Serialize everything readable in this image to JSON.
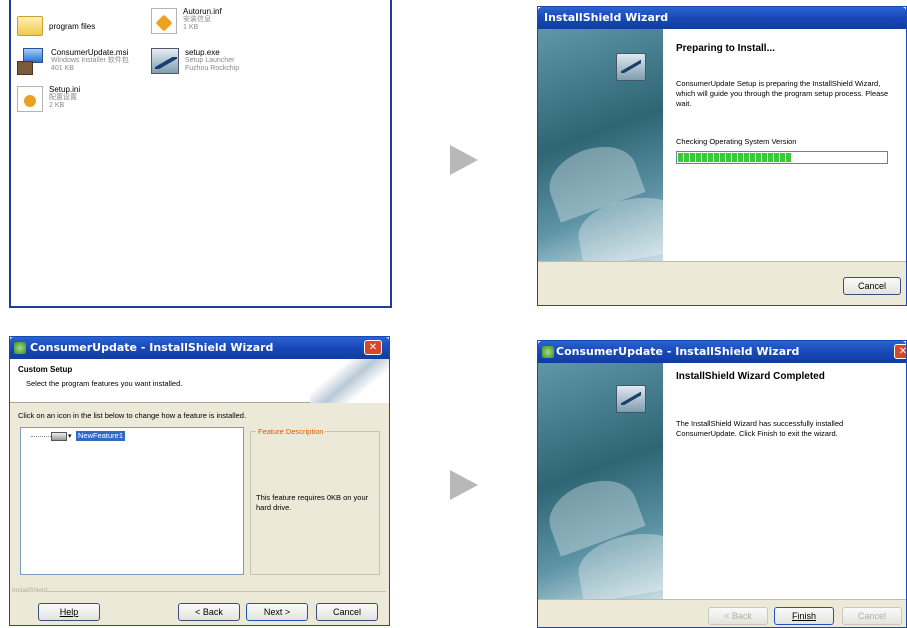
{
  "explorer": {
    "files": [
      {
        "name": "program files",
        "type": "",
        "size": "",
        "icon": "folder-icon"
      },
      {
        "name": "Autorun.inf",
        "type": "安装信息",
        "size": "1 KB",
        "icon": "setup-info-icon"
      },
      {
        "name": "ConsumerUpdate.msi",
        "type": "Windows Installer 软件包",
        "size": "401 KB",
        "icon": "msi-package-icon"
      },
      {
        "name": "setup.exe",
        "type": "Setup Launcher",
        "size": "Fuzhou Rockchip",
        "icon": "setup-launcher-icon"
      },
      {
        "name": "Setup.ini",
        "type": "配置设置",
        "size": "2 KB",
        "icon": "settings-file-icon"
      }
    ]
  },
  "preparing": {
    "title": "InstallShield Wizard",
    "heading": "Preparing to Install...",
    "body": "ConsumerUpdate Setup is preparing the InstallShield Wizard, which will guide you through the program setup process.  Please wait.",
    "status": "Checking Operating System Version",
    "progress": 0.55,
    "cancel": "Cancel"
  },
  "custom": {
    "title": "ConsumerUpdate - InstallShield Wizard",
    "heading": "Custom Setup",
    "subheading": "Select the program features you want installed.",
    "instruction": "Click on an icon in the list below to change how a feature is installed.",
    "feature": "NewFeature1",
    "desc_label": "Feature Description",
    "desc_text": "This feature requires 0KB on your hard drive.",
    "brand": "InstallShield",
    "help": "Help",
    "back": "< Back",
    "next": "Next >",
    "cancel": "Cancel"
  },
  "completed": {
    "title": "ConsumerUpdate - InstallShield Wizard",
    "heading": "InstallShield Wizard Completed",
    "body": "The InstallShield Wizard has successfully installed ConsumerUpdate. Click Finish to exit the wizard.",
    "back": "< Back",
    "finish": "Finish",
    "cancel": "Cancel"
  },
  "colors": {
    "titlebar": "#1f53c4",
    "progress": "#3cc83c",
    "dialog_bg": "#ece9d8",
    "highlight": "#316ac5",
    "arrow": "#b8b8b8"
  }
}
